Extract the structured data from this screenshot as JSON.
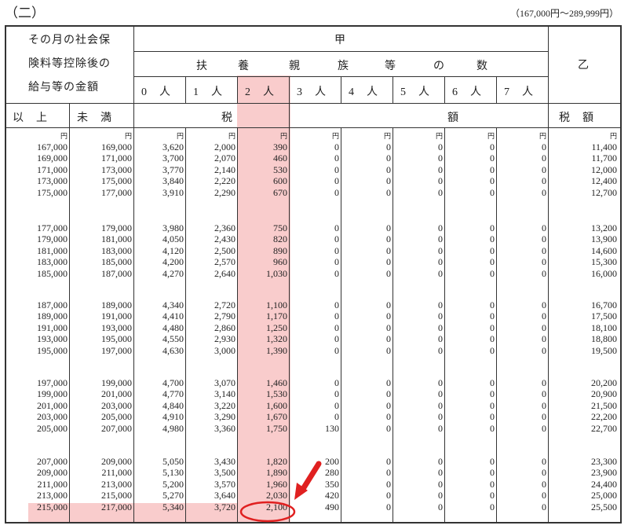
{
  "page": {
    "section_label": "（二）",
    "range_label": "（167,000円～289,999円）"
  },
  "header": {
    "left_line1": "その月の社会保",
    "left_line2": "険料等控除後の",
    "left_line3": "給与等の金額",
    "kou": "甲",
    "fuyou": [
      "扶",
      "養",
      "親",
      "族",
      "等",
      "の",
      "数"
    ],
    "otsu": "乙",
    "persons": [
      "0　人",
      "1　人",
      "2　人",
      "3　人",
      "4　人",
      "5　人",
      "6　人",
      "7　人"
    ],
    "ijou": "以　上",
    "miman": "未　満",
    "zei": "税",
    "gaku": "額",
    "zeigaku": "税　額",
    "unit": "円"
  },
  "rows": [
    [
      "167,000",
      "169,000",
      "3,620",
      "2,000",
      "390",
      "0",
      "0",
      "0",
      "0",
      "0",
      "11,400"
    ],
    [
      "169,000",
      "171,000",
      "3,700",
      "2,070",
      "460",
      "0",
      "0",
      "0",
      "0",
      "0",
      "11,700"
    ],
    [
      "171,000",
      "173,000",
      "3,770",
      "2,140",
      "530",
      "0",
      "0",
      "0",
      "0",
      "0",
      "12,000"
    ],
    [
      "173,000",
      "175,000",
      "3,840",
      "2,220",
      "600",
      "0",
      "0",
      "0",
      "0",
      "0",
      "12,400"
    ],
    [
      "175,000",
      "177,000",
      "3,910",
      "2,290",
      "670",
      "0",
      "0",
      "0",
      "0",
      "0",
      "12,700"
    ],
    [
      "177,000",
      "179,000",
      "3,980",
      "2,360",
      "750",
      "0",
      "0",
      "0",
      "0",
      "0",
      "13,200"
    ],
    [
      "179,000",
      "181,000",
      "4,050",
      "2,430",
      "820",
      "0",
      "0",
      "0",
      "0",
      "0",
      "13,900"
    ],
    [
      "181,000",
      "183,000",
      "4,120",
      "2,500",
      "890",
      "0",
      "0",
      "0",
      "0",
      "0",
      "14,600"
    ],
    [
      "183,000",
      "185,000",
      "4,200",
      "2,570",
      "960",
      "0",
      "0",
      "0",
      "0",
      "0",
      "15,300"
    ],
    [
      "185,000",
      "187,000",
      "4,270",
      "2,640",
      "1,030",
      "0",
      "0",
      "0",
      "0",
      "0",
      "16,000"
    ],
    [
      "187,000",
      "189,000",
      "4,340",
      "2,720",
      "1,100",
      "0",
      "0",
      "0",
      "0",
      "0",
      "16,700"
    ],
    [
      "189,000",
      "191,000",
      "4,410",
      "2,790",
      "1,170",
      "0",
      "0",
      "0",
      "0",
      "0",
      "17,500"
    ],
    [
      "191,000",
      "193,000",
      "4,480",
      "2,860",
      "1,250",
      "0",
      "0",
      "0",
      "0",
      "0",
      "18,100"
    ],
    [
      "193,000",
      "195,000",
      "4,550",
      "2,930",
      "1,320",
      "0",
      "0",
      "0",
      "0",
      "0",
      "18,800"
    ],
    [
      "195,000",
      "197,000",
      "4,630",
      "3,000",
      "1,390",
      "0",
      "0",
      "0",
      "0",
      "0",
      "19,500"
    ],
    [
      "197,000",
      "199,000",
      "4,700",
      "3,070",
      "1,460",
      "0",
      "0",
      "0",
      "0",
      "0",
      "20,200"
    ],
    [
      "199,000",
      "201,000",
      "4,770",
      "3,140",
      "1,530",
      "0",
      "0",
      "0",
      "0",
      "0",
      "20,900"
    ],
    [
      "201,000",
      "203,000",
      "4,840",
      "3,220",
      "1,600",
      "0",
      "0",
      "0",
      "0",
      "0",
      "21,500"
    ],
    [
      "203,000",
      "205,000",
      "4,910",
      "3,290",
      "1,670",
      "0",
      "0",
      "0",
      "0",
      "0",
      "22,200"
    ],
    [
      "205,000",
      "207,000",
      "4,980",
      "3,360",
      "1,750",
      "130",
      "0",
      "0",
      "0",
      "0",
      "22,700"
    ],
    [
      "207,000",
      "209,000",
      "5,050",
      "3,430",
      "1,820",
      "200",
      "0",
      "0",
      "0",
      "0",
      "23,300"
    ],
    [
      "209,000",
      "211,000",
      "5,130",
      "3,500",
      "1,890",
      "280",
      "0",
      "0",
      "0",
      "0",
      "23,900"
    ],
    [
      "211,000",
      "213,000",
      "5,200",
      "3,570",
      "1,960",
      "350",
      "0",
      "0",
      "0",
      "0",
      "24,400"
    ],
    [
      "213,000",
      "215,000",
      "5,270",
      "3,640",
      "2,030",
      "420",
      "0",
      "0",
      "0",
      "0",
      "25,000"
    ],
    [
      "215,000",
      "217,000",
      "5,340",
      "3,720",
      "2,100",
      "490",
      "0",
      "0",
      "0",
      "0",
      "25,500"
    ]
  ],
  "highlight_color": "#f07878",
  "annotation_color": "#e02020"
}
